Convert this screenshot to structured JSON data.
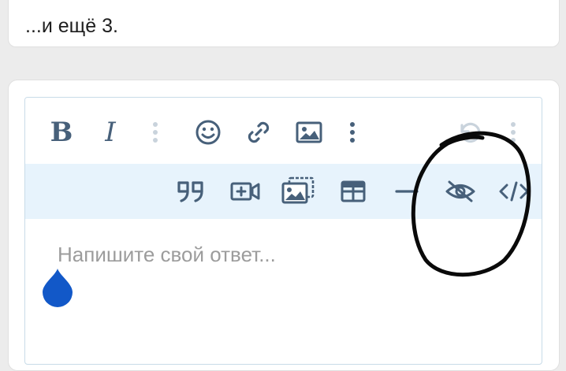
{
  "previous_post": {
    "more_text": "...и ещё 3."
  },
  "editor": {
    "placeholder": "Напишите свой ответ...",
    "toolbar_row1": {
      "bold_label": "B",
      "italic_label": "I"
    },
    "colors": {
      "icon": "#47607a",
      "icon_disabled": "#c9d3dc",
      "toolbar_row2_bg": "#e7f3fc",
      "border": "#c8dbe8",
      "cursor_drop": "#1258c8"
    },
    "icons_row1": [
      "bold-icon",
      "italic-icon",
      "more-vertical-icon",
      "emoji-icon",
      "link-icon",
      "image-icon",
      "more-vertical-icon",
      "undo-icon",
      "more-vertical-icon"
    ],
    "icons_row2": [
      "quote-icon",
      "video-icon",
      "gallery-icon",
      "table-icon",
      "horizontal-line-icon",
      "hide-eye-icon",
      "code-icon"
    ]
  }
}
